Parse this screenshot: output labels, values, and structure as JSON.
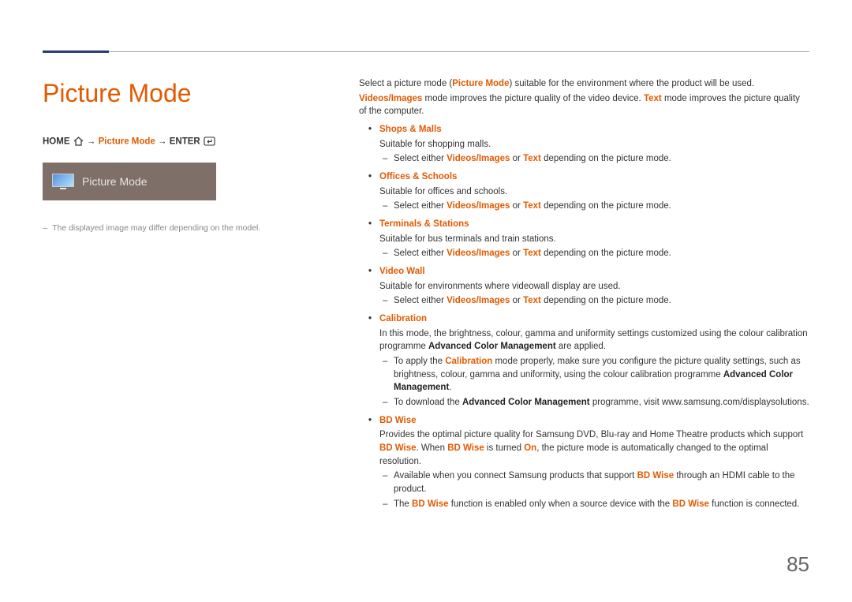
{
  "page": {
    "title": "Picture Mode",
    "number": "85",
    "disclaimer": "The displayed image may differ depending on the model."
  },
  "breadcrumb": {
    "home": "HOME",
    "arrow": " → ",
    "mid": "Picture Mode",
    "enter": "ENTER"
  },
  "preview": {
    "label": "Picture Mode"
  },
  "intro": {
    "line1_pre": "Select a picture mode (",
    "line1_hl": "Picture Mode",
    "line1_post": ") suitable for the environment where the product will be used.",
    "line2_hl1": "Videos/Images",
    "line2_mid": " mode improves the picture quality of the video device. ",
    "line2_hl2": "Text",
    "line2_post": " mode improves the picture quality of the computer."
  },
  "select_tpl": {
    "pre": "Select either ",
    "h1": "Videos/Images",
    "mid": " or ",
    "h2": "Text",
    "post": " depending on the picture mode."
  },
  "modes": {
    "shops": {
      "name": "Shops & Malls",
      "desc": "Suitable for shopping malls."
    },
    "offices": {
      "name": "Offices & Schools",
      "desc": "Suitable for offices and schools."
    },
    "terminals": {
      "name": "Terminals & Stations",
      "desc": "Suitable for bus terminals and train stations."
    },
    "videowall": {
      "name": "Video Wall",
      "desc": "Suitable for environments where videowall display are used."
    },
    "calibration": {
      "name": "Calibration",
      "desc_pre": "In this mode, the brightness, colour, gamma and uniformity settings customized using the colour calibration programme ",
      "desc_bold": "Advanced Color Management",
      "desc_post": " are applied.",
      "sub1_pre": "To apply the ",
      "sub1_hl": "Calibration",
      "sub1_mid": " mode properly, make sure you configure the picture quality settings, such as brightness, colour, gamma and uniformity, using the colour calibration programme ",
      "sub1_bold": "Advanced Color Management",
      "sub1_post": ".",
      "sub2_pre": "To download the ",
      "sub2_bold": "Advanced Color Management",
      "sub2_post": " programme, visit www.samsung.com/displaysolutions."
    },
    "bdwise": {
      "name": "BD Wise",
      "desc_pre": "Provides the optimal picture quality for Samsung DVD, Blu-ray and Home Theatre products which support ",
      "desc_hl": "BD Wise",
      "desc_post": ". When ",
      "desc_hl2": "BD Wise",
      "desc_mid2": " is turned ",
      "desc_hl3": "On",
      "desc_post2": ", the picture mode is automatically changed to the optimal resolution.",
      "sub1_pre": "Available when you connect Samsung products that support ",
      "sub1_hl": "BD Wise",
      "sub1_post": " through an HDMI cable to the product.",
      "sub2_pre": "The ",
      "sub2_hl": "BD Wise",
      "sub2_mid": " function is enabled only when a source device with the ",
      "sub2_hl2": "BD Wise",
      "sub2_post": " function is connected."
    }
  }
}
